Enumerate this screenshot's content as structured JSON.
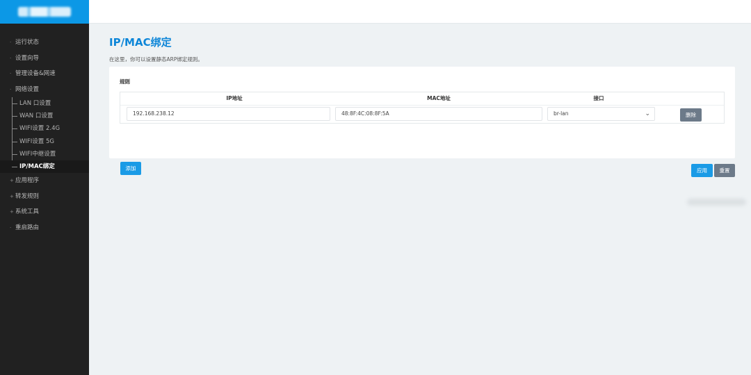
{
  "sidebar": {
    "items": [
      {
        "bullet": "·",
        "label": "运行状态"
      },
      {
        "bullet": "·",
        "label": "设置向导"
      },
      {
        "bullet": "·",
        "label": "管理设备&网速"
      },
      {
        "bullet": "·",
        "label": "网络设置"
      }
    ],
    "network_sub": [
      {
        "label": "LAN 口设置"
      },
      {
        "label": "WAN 口设置"
      },
      {
        "label": "WIFI设置 2.4G"
      },
      {
        "label": "WIFI设置 5G"
      },
      {
        "label": "WIFI中继设置"
      },
      {
        "label": "IP/MAC绑定"
      }
    ],
    "items_after": [
      {
        "bullet": "+",
        "label": "应用程序"
      },
      {
        "bullet": "+",
        "label": "转发规则"
      },
      {
        "bullet": "+",
        "label": "系统工具"
      },
      {
        "bullet": "·",
        "label": "重启路由"
      }
    ]
  },
  "main": {
    "title": "IP/MAC绑定",
    "description": "在这里，你可以设置静态ARP绑定规则。",
    "section_label": "规则",
    "columns": [
      "IP地址",
      "MAC地址",
      "接口"
    ],
    "row": {
      "ip": "192.168.238.12",
      "mac": "48:8F:4C:08:8F:5A",
      "interface": "br-lan",
      "delete_label": "删除"
    },
    "add_label": "添加",
    "apply_label": "应用",
    "reset_label": "重置"
  },
  "colors": {
    "accent": "#0c98e6",
    "sidebar_bg": "#212121",
    "title": "#0d86d8",
    "secondary_button": "#6c7a89"
  }
}
